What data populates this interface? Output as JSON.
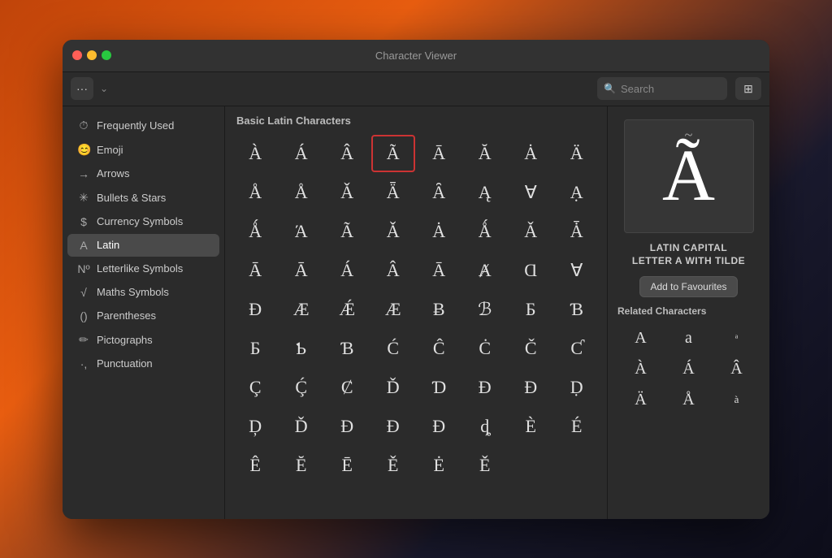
{
  "window": {
    "title": "Character Viewer"
  },
  "toolbar": {
    "options_label": "···",
    "chevron_label": "⌄",
    "search_placeholder": "Search",
    "grid_icon": "⊞"
  },
  "sidebar": {
    "items": [
      {
        "id": "frequently-used",
        "icon": "🕐",
        "label": "Frequently Used",
        "active": false
      },
      {
        "id": "emoji",
        "icon": "😊",
        "label": "Emoji",
        "active": false
      },
      {
        "id": "arrows",
        "icon": "→",
        "label": "Arrows",
        "active": false
      },
      {
        "id": "bullets-stars",
        "icon": "✳",
        "label": "Bullets & Stars",
        "active": false
      },
      {
        "id": "currency-symbols",
        "icon": "$",
        "label": "Currency Symbols",
        "active": false
      },
      {
        "id": "latin",
        "icon": "A",
        "label": "Latin",
        "active": true
      },
      {
        "id": "letterlike-symbols",
        "icon": "№",
        "label": "Letterlike Symbols",
        "active": false
      },
      {
        "id": "maths-symbols",
        "icon": "√",
        "label": "Maths Symbols",
        "active": false
      },
      {
        "id": "parentheses",
        "icon": "()",
        "label": "Parentheses",
        "active": false
      },
      {
        "id": "pictographs",
        "icon": "✏",
        "label": "Pictographs",
        "active": false
      },
      {
        "id": "punctuation",
        "icon": ".,",
        "label": "Punctuation",
        "active": false
      }
    ]
  },
  "char_panel": {
    "header": "Basic Latin Characters",
    "characters": [
      "À",
      "Á",
      "Â",
      "Ã",
      "Ā",
      "Ă",
      "Ȧ",
      "Ä",
      "Å",
      "Å",
      "Ǎ",
      "Ǟ",
      "Ȃ",
      "Ą",
      "Ɐ",
      "Ạ",
      "Ǻ",
      "Ά",
      "Ã",
      "Ǎ",
      "Ȧ",
      "Ǻ",
      "Ǎ",
      "Ǡ",
      "Ā",
      "Ā",
      "Á",
      "Â",
      "Ā",
      "Ⱥ",
      "Ɑ",
      "Ɐ",
      "Ð",
      "Æ",
      "Ǽ",
      "Æ",
      "Ƀ",
      "ℬ",
      "Ƃ",
      "Ɓ",
      "Б",
      "Ƅ",
      "Ɓ",
      "Ć",
      "Ĉ",
      "Ċ",
      "Č",
      "Ƈ",
      "Ç",
      "Ḉ",
      "Ȼ",
      "Ď",
      "Ɗ",
      "Ð",
      "Đ",
      "Ḍ",
      "Ḑ",
      "Ď",
      "Đ",
      "Đ",
      "Đ",
      "ȡ",
      "È",
      "É",
      "Ê",
      "Ĕ",
      "Ē",
      "Ě",
      "Ė",
      "Ě"
    ],
    "selected_index": 3
  },
  "detail": {
    "char": "Ã",
    "tilde_mark": "~",
    "name_line1": "LATIN CAPITAL",
    "name_line2": "LETTER A WITH TILDE",
    "add_fav_label": "Add to Favourites",
    "related_title": "Related Characters",
    "related_chars": [
      "A",
      "a",
      "ᵃ",
      "À",
      "Á",
      "Â",
      "Ä",
      "Å",
      "à"
    ]
  }
}
